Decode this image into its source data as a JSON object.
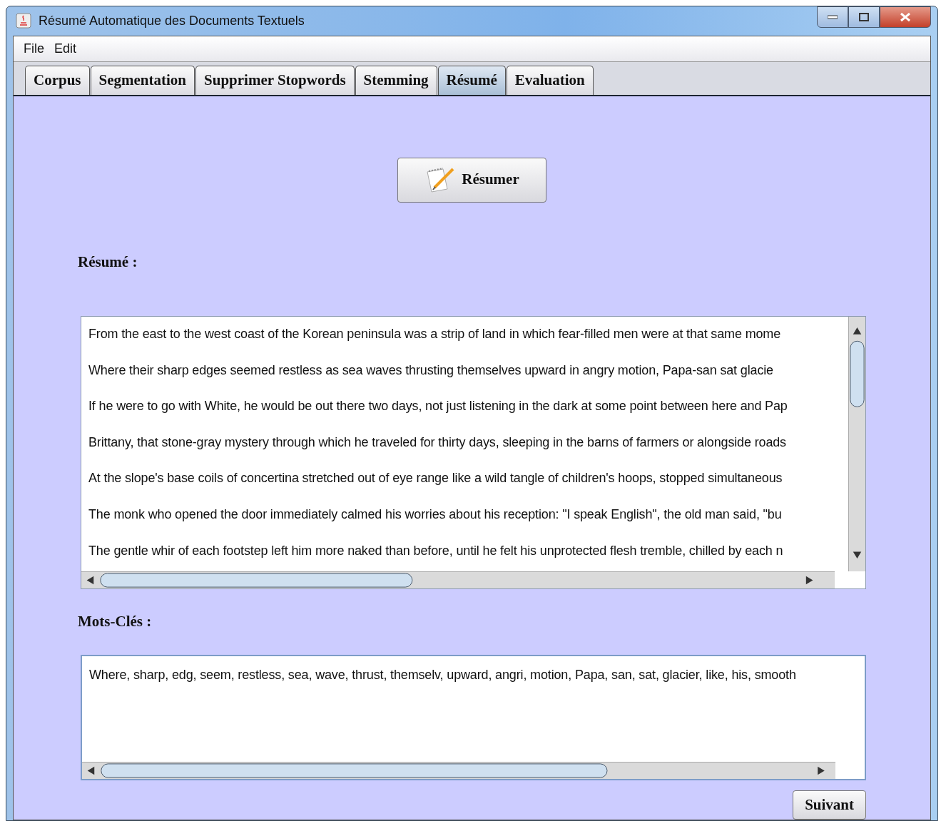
{
  "window": {
    "title": "Résumé Automatique des Documents Textuels"
  },
  "menu": [
    "File",
    "Edit"
  ],
  "tabs": [
    {
      "label": "Corpus",
      "selected": false
    },
    {
      "label": "Segmentation",
      "selected": false
    },
    {
      "label": "Supprimer Stopwords",
      "selected": false
    },
    {
      "label": "Stemming",
      "selected": false
    },
    {
      "label": "Résumé",
      "selected": true
    },
    {
      "label": "Evaluation",
      "selected": false
    }
  ],
  "summarize_button": "Résumer",
  "summary": {
    "label": "Résumé :",
    "lines": [
      "From the east to the west coast of the Korean peninsula was a strip of land in which fear-filled men were at that same mome",
      "Where their sharp edges seemed restless as sea waves thrusting themselves upward in angry motion, Papa-san sat glacie",
      "If he were to go with White, he would be out there two days, not just listening in the dark at some point between here and Pap",
      "Brittany, that stone-gray mystery through which he traveled for thirty days, sleeping in the barns of farmers or alongside roads",
      "At the slope's base coils of concertina stretched out of eye range like a wild tangle of children's hoops, stopped simultaneous",
      "The monk who opened the door immediately calmed his worries about his reception: \"I speak English\", the old man said, \"bu",
      "The gentle whir of each footstep left him more naked than before, until he felt his unprotected flesh tremble, chilled by each n"
    ]
  },
  "keywords": {
    "label": "Mots-Clés :",
    "text": "Where, sharp, edg, seem, restless, sea, wave, thrust, themselv, upward, angri, motion, Papa, san, sat, glacier, like, his, smooth"
  },
  "next_button": "Suivant"
}
